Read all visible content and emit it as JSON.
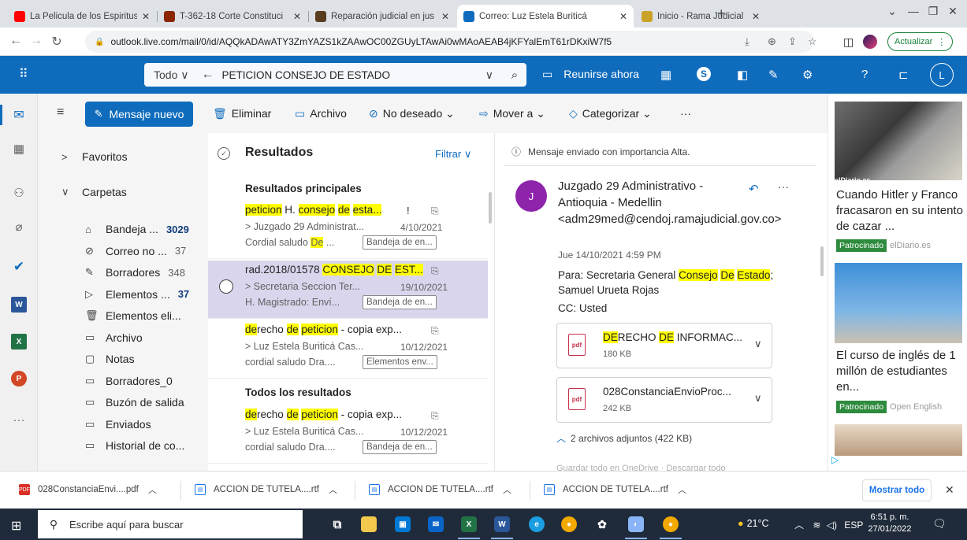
{
  "browser": {
    "tabs": [
      {
        "title": "La Pelicula de los Espiritus",
        "favicon": "youtube-icon",
        "color": "#ff0000"
      },
      {
        "title": "T-362-18 Corte Constituci",
        "favicon": "seal-icon",
        "color": "#8b2500"
      },
      {
        "title": "Reparación judicial en jus",
        "favicon": "seal-icon",
        "color": "#5a3d1e"
      },
      {
        "title": "Correo: Luz Estela Buriticá",
        "favicon": "outlook-icon",
        "color": "#0f6cbd"
      },
      {
        "title": "Inicio - Rama Judicial",
        "favicon": "seal-icon",
        "color": "#c9a227"
      }
    ],
    "url": "outlook.live.com/mail/0/id/AQQkADAwATY3ZmYAZS1kZAAwOC00ZGUyLTAwAi0wMAoAEAB4jKFYalEmT61rDKxiW7f5",
    "update_label": "Actualizar"
  },
  "outlook": {
    "search_scope": "Todo",
    "search_query": "PETICION CONSEJO DE ESTADO",
    "meet_now": "Reunirse ahora",
    "avatar_initial": "L",
    "new_mail": "Mensaje nuevo",
    "commands": {
      "delete": "Eliminar",
      "archive": "Archivo",
      "junk": "No deseado",
      "move": "Mover a",
      "categorize": "Categorizar",
      "more": "···"
    },
    "folders": {
      "favorites": "Favoritos",
      "folders": "Carpetas",
      "items": [
        {
          "label": "Bandeja ...",
          "count": "3029",
          "bold": true,
          "icon": "inbox-icon"
        },
        {
          "label": "Correo no ...",
          "count": "37",
          "bold": false,
          "icon": "junk-icon"
        },
        {
          "label": "Borradores",
          "count": "348",
          "bold": false,
          "icon": "pencil-icon"
        },
        {
          "label": "Elementos ...",
          "count": "37",
          "bold": true,
          "icon": "send-icon"
        },
        {
          "label": "Elementos eli...",
          "count": "",
          "bold": false,
          "icon": "trash-icon"
        },
        {
          "label": "Archivo",
          "count": "",
          "bold": false,
          "icon": "archive-icon"
        },
        {
          "label": "Notas",
          "count": "",
          "bold": false,
          "icon": "note-icon"
        },
        {
          "label": "Borradores_0",
          "count": "",
          "bold": false,
          "icon": "folder-icon"
        },
        {
          "label": "Buzón de salida",
          "count": "",
          "bold": false,
          "icon": "folder-icon"
        },
        {
          "label": "Enviados",
          "count": "",
          "bold": false,
          "icon": "folder-icon"
        },
        {
          "label": "Historial de co...",
          "count": "",
          "bold": false,
          "icon": "folder-icon"
        }
      ]
    },
    "list": {
      "title": "Resultados",
      "filter": "Filtrar",
      "top_results": "Resultados principales",
      "all_results": "Todos los resultados",
      "messages": [
        {
          "subject_parts": [
            [
              "peticion",
              true
            ],
            [
              " H. ",
              false
            ],
            [
              "consejo",
              true
            ],
            [
              " ",
              false
            ],
            [
              "de",
              true
            ],
            [
              " ",
              false
            ],
            [
              "esta...",
              true
            ]
          ],
          "from": "> Juzgado 29 Administrat...",
          "date": "4/10/2021",
          "preview_parts": [
            [
              "Cordial saludo ",
              false
            ],
            [
              "De",
              true
            ],
            [
              " ...",
              false
            ]
          ],
          "folder": "Bandeja de en...",
          "important": true
        },
        {
          "subject_parts": [
            [
              "rad.2018/01578 ",
              false
            ],
            [
              "CONSEJO",
              true
            ],
            [
              " ",
              false
            ],
            [
              "DE",
              true
            ],
            [
              " ",
              false
            ],
            [
              "EST...",
              true
            ]
          ],
          "from": "> Secretaria Seccion Ter...",
          "date": "19/10/2021",
          "preview_parts": [
            [
              "H. Magistrado: Enví...",
              false
            ]
          ],
          "folder": "Bandeja de en...",
          "important": false
        },
        {
          "subject_parts": [
            [
              "de",
              true
            ],
            [
              "recho ",
              false
            ],
            [
              "de",
              true
            ],
            [
              " ",
              false
            ],
            [
              "peticion",
              true
            ],
            [
              " - copia exp...",
              false
            ]
          ],
          "from": "> Luz Estela Buriticá Cas...",
          "date": "10/12/2021",
          "preview_parts": [
            [
              "cordial saludo Dra....",
              false
            ]
          ],
          "folder": "Elementos env...",
          "important": false
        },
        {
          "subject_parts": [
            [
              "de",
              true
            ],
            [
              "recho ",
              false
            ],
            [
              "de",
              true
            ],
            [
              " ",
              false
            ],
            [
              "peticion",
              true
            ],
            [
              " - copia exp...",
              false
            ]
          ],
          "from": "> Luz Estela Buriticá Cas...",
          "date": "10/12/2021",
          "preview_parts": [
            [
              "cordial saludo Dra....",
              false
            ]
          ],
          "folder": "Bandeja de en...",
          "important": false
        }
      ]
    },
    "reading": {
      "info": "Mensaje enviado con importancia Alta.",
      "avatar_initial": "J",
      "sender": "Juzgado 29 Administrativo - Antioquia - Medellin <adm29med@cendoj.ramajudicial.gov.co>",
      "date": "Jue 14/10/2021 4:59 PM",
      "to_parts": [
        [
          "Para: Secretaria General ",
          false
        ],
        [
          "Consejo",
          true
        ],
        [
          " ",
          false
        ],
        [
          "De",
          true
        ],
        [
          " ",
          false
        ],
        [
          "Estado",
          true
        ],
        [
          "; Samuel Urueta Rojas",
          false
        ]
      ],
      "cc": "CC: Usted",
      "attachments": [
        {
          "name_parts": [
            [
              "DE",
              true
            ],
            [
              "RECHO ",
              false
            ],
            [
              "DE",
              true
            ],
            [
              " INFORMAC...",
              false
            ]
          ],
          "size": "180 KB"
        },
        {
          "name_parts": [
            [
              "028ConstanciaEnvioProc...",
              false
            ]
          ],
          "size": "242 KB"
        }
      ],
      "attach_summary": "2 archivos adjuntos (422 KB)",
      "save_bar": "Guardar todo en OneDrive · Descargar todo"
    },
    "ads": [
      {
        "title": "Cuando Hitler y Franco fracasaron en su intento de cazar ...",
        "source": "elDiario.es",
        "logo": "elDiario.es"
      },
      {
        "title": "El curso de inglés de 1 millón de estudiantes en...",
        "source": "Open English"
      }
    ],
    "sponsored_label": "Patrocinado"
  },
  "downloads": {
    "items": [
      "028ConstanciaEnvi....pdf",
      "ACCION DE TUTELA....rtf",
      "ACCION DE TUTELA....rtf",
      "ACCION DE TUTELA....rtf"
    ],
    "show_all": "Mostrar todo"
  },
  "taskbar": {
    "search_placeholder": "Escribe aquí para buscar",
    "weather": "21°C",
    "lang": "ESP",
    "time": "6:51 p. m.",
    "date": "27/01/2022",
    "notifications": "1"
  }
}
